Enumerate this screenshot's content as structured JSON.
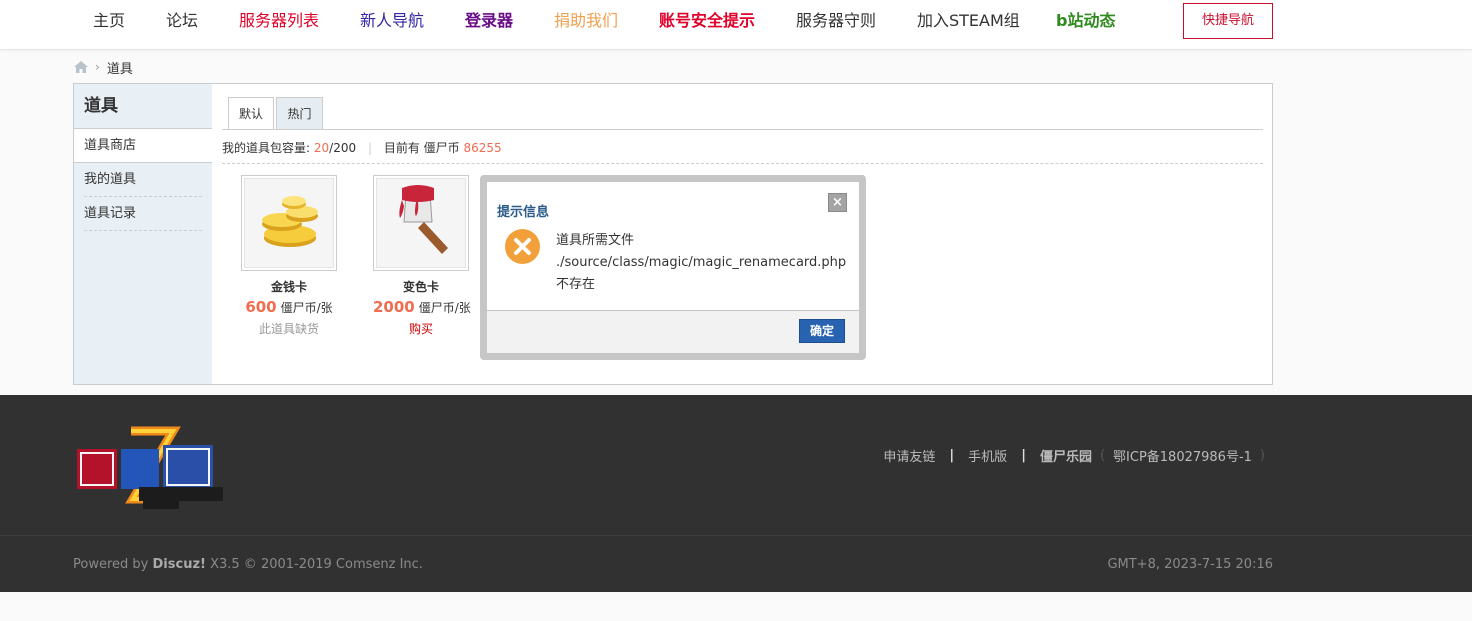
{
  "nav": {
    "items": [
      {
        "label": "主页",
        "color": "#333333"
      },
      {
        "label": "论坛",
        "color": "#333333"
      },
      {
        "label": "服务器列表",
        "color": "#e0002a"
      },
      {
        "label": "新人导航",
        "color": "#3326a6"
      },
      {
        "label": "登录器",
        "color": "#6a0d86"
      },
      {
        "label": "捐助我们",
        "color": "#f0a050"
      },
      {
        "label": "账号安全提示",
        "color": "#e0002a"
      },
      {
        "label": "服务器守则",
        "color": "#333333"
      },
      {
        "label": "加入STEAM组",
        "color": "#333333"
      },
      {
        "label": "b站动态",
        "color": "#2f8a1f"
      }
    ],
    "quick_nav_label": "快捷导航"
  },
  "breadcrumb": {
    "home_icon": "home-icon",
    "current": "道具"
  },
  "sidebar": {
    "title": "道具",
    "items": [
      {
        "label": "道具商店"
      },
      {
        "label": "我的道具"
      },
      {
        "label": "道具记录"
      }
    ]
  },
  "tabs": [
    {
      "label": "默认"
    },
    {
      "label": "热门"
    }
  ],
  "capacity": {
    "prefix": "我的道具包容量:",
    "used": "20",
    "total": "/200",
    "balance_prefix": "目前有 僵尸币",
    "balance": "86255"
  },
  "items": [
    {
      "name": "金钱卡",
      "price": "600",
      "unit": "僵尸币/张",
      "status": "此道具缺货"
    },
    {
      "name": "变色卡",
      "price": "2000",
      "unit": "僵尸币/张",
      "status": "购买"
    }
  ],
  "hidden_card_fragment": "张",
  "dialog": {
    "title": "提示信息",
    "close_glyph": "×",
    "message_line1": "道具所需文件",
    "message_line2": "./source/class/magic/magic_renamecard.php",
    "message_line3": "不存在",
    "ok_label": "确定"
  },
  "footer": {
    "links": [
      "申请友链",
      "手机版",
      "僵尸乐园"
    ],
    "separator": "|",
    "paren_open": "(",
    "icp": "鄂ICP备18027986号-1",
    "paren_close": ")",
    "powered_prefix": "Powered by",
    "powered_brand": "Discuz!",
    "powered_suffix": "X3.5 © 2001-2019 Comsenz Inc.",
    "time": "GMT+8, 2023-7-15 20:16"
  }
}
